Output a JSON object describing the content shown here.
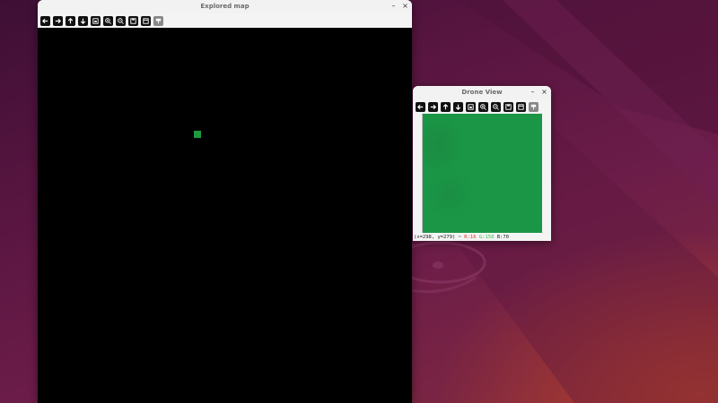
{
  "explored_window": {
    "title": "Explored map",
    "minimize_glyph": "–",
    "close_glyph": "×",
    "toolbar_icons": [
      "arrow-left-icon",
      "arrow-right-icon",
      "arrow-up-icon",
      "arrow-down-icon",
      "fit-window-icon",
      "zoom-in-icon",
      "zoom-out-icon",
      "save-icon",
      "properties-icon",
      "overlay-icon"
    ],
    "map_background": "#000000",
    "explored_tile_color": "#1f9a3f"
  },
  "drone_window": {
    "title": "Drone View",
    "minimize_glyph": "–",
    "close_glyph": "×",
    "toolbar_icons": [
      "arrow-left-icon",
      "arrow-right-icon",
      "arrow-up-icon",
      "arrow-down-icon",
      "fit-window-icon",
      "zoom-in-icon",
      "zoom-out-icon",
      "save-icon",
      "properties-icon",
      "overlay-icon"
    ],
    "image_color": "#1a9646",
    "status": {
      "coords": "(x=298, y=279) ~",
      "r": "R:16",
      "g": "G:150",
      "b": "B:70"
    }
  }
}
